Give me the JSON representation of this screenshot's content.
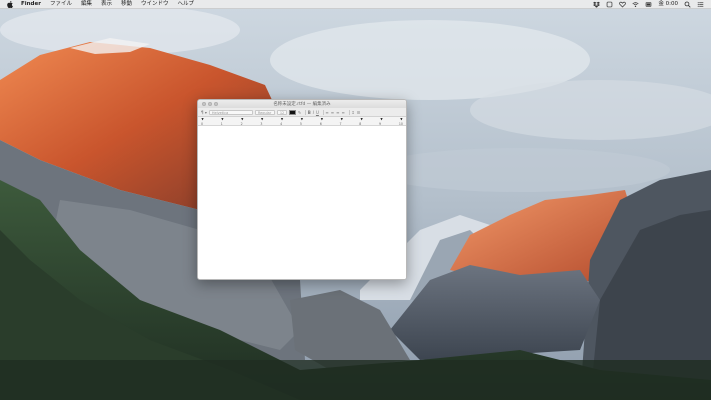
{
  "menubar": {
    "apple_icon": "apple-logo-icon",
    "items": [
      "Finder",
      "ファイル",
      "編集",
      "表示",
      "移動",
      "ウインドウ",
      "ヘルプ"
    ],
    "status_icons": [
      "dropbox-icon",
      "notification-badge-icon",
      "heart-icon",
      "wifi-icon",
      "battery-icon"
    ],
    "clock": "金 0:00",
    "search_icon": "spotlight-search-icon",
    "menu_icon": "notification-center-icon"
  },
  "window": {
    "title": "名称未設定.rtfd — 編集済み",
    "toolbar": {
      "paragraph_style": "¶ ▾",
      "font_family": "Helvetica",
      "font_style": "Regular",
      "font_size": "12",
      "bold": "B",
      "italic": "I",
      "underline": "U"
    },
    "ruler": {
      "numbers": [
        "0",
        "1",
        "2",
        "3",
        "4",
        "5",
        "6",
        "7",
        "8",
        "9",
        "10"
      ]
    }
  },
  "colors": {
    "menubar_bg": "#ececec",
    "window_bg": "#ffffff",
    "cliff_glow": "#e0683a"
  }
}
